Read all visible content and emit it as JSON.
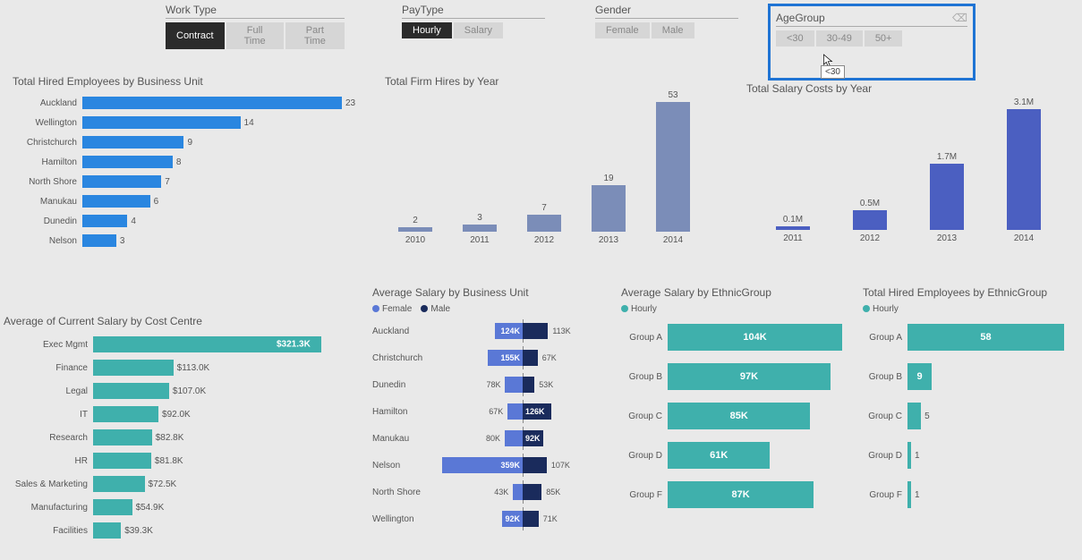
{
  "slicers": {
    "workType": {
      "title": "Work Type",
      "options": [
        "Contract",
        "Full Time",
        "Part Time"
      ],
      "active": 0
    },
    "payType": {
      "title": "PayType",
      "options": [
        "Hourly",
        "Salary"
      ],
      "active": 0
    },
    "gender": {
      "title": "Gender",
      "options": [
        "Female",
        "Male"
      ],
      "active": -1
    },
    "ageGroup": {
      "title": "AgeGroup",
      "options": [
        "<30",
        "30-49",
        "50+"
      ],
      "active": -1,
      "tooltip": "<30"
    }
  },
  "charts": {
    "hiredByBU": {
      "title": "Total Hired Employees by Business Unit",
      "rows": [
        {
          "label": "Auckland",
          "value": 23
        },
        {
          "label": "Wellington",
          "value": 14
        },
        {
          "label": "Christchurch",
          "value": 9
        },
        {
          "label": "Hamilton",
          "value": 8
        },
        {
          "label": "North Shore",
          "value": 7
        },
        {
          "label": "Manukau",
          "value": 6
        },
        {
          "label": "Dunedin",
          "value": 4
        },
        {
          "label": "Nelson",
          "value": 3
        }
      ]
    },
    "salaryByCC": {
      "title": "Average of Current Salary by Cost Centre",
      "rows": [
        {
          "label": "Exec Mgmt",
          "value_label": "$321.3K",
          "value": 321.3
        },
        {
          "label": "Finance",
          "value_label": "$113.0K",
          "value": 113.0
        },
        {
          "label": "Legal",
          "value_label": "$107.0K",
          "value": 107.0
        },
        {
          "label": "IT",
          "value_label": "$92.0K",
          "value": 92.0
        },
        {
          "label": "Research",
          "value_label": "$82.8K",
          "value": 82.8
        },
        {
          "label": "HR",
          "value_label": "$81.8K",
          "value": 81.8
        },
        {
          "label": "Sales & Marketing",
          "value_label": "$72.5K",
          "value": 72.5
        },
        {
          "label": "Manufacturing",
          "value_label": "$54.9K",
          "value": 54.9
        },
        {
          "label": "Facilities",
          "value_label": "$39.3K",
          "value": 39.3
        }
      ]
    },
    "hiresByYear": {
      "title": "Total Firm Hires by Year",
      "cols": [
        {
          "label": "2010",
          "value": 2
        },
        {
          "label": "2011",
          "value": 3
        },
        {
          "label": "2012",
          "value": 7
        },
        {
          "label": "2013",
          "value": 19
        },
        {
          "label": "2014",
          "value": 53
        }
      ]
    },
    "salaryCostsByYear": {
      "title": "Total Salary Costs by Year",
      "cols": [
        {
          "label": "2011",
          "value_label": "0.1M",
          "value": 0.1
        },
        {
          "label": "2012",
          "value_label": "0.5M",
          "value": 0.5
        },
        {
          "label": "2013",
          "value_label": "1.7M",
          "value": 1.7
        },
        {
          "label": "2014",
          "value_label": "3.1M",
          "value": 3.1
        }
      ]
    },
    "salaryByBU": {
      "title": "Average Salary by Business Unit",
      "legend": {
        "female": "Female",
        "male": "Male"
      },
      "rows": [
        {
          "label": "Auckland",
          "female": 124,
          "female_label": "124K",
          "male": 113,
          "male_label": "113K",
          "f_in": true,
          "m_in": false
        },
        {
          "label": "Christchurch",
          "female": 155,
          "female_label": "155K",
          "male": 67,
          "male_label": "67K",
          "f_in": true,
          "m_in": false
        },
        {
          "label": "Dunedin",
          "female": 78,
          "female_label": "78K",
          "male": 53,
          "male_label": "53K",
          "f_in": false,
          "m_in": false
        },
        {
          "label": "Hamilton",
          "female": 67,
          "female_label": "67K",
          "male": 126,
          "male_label": "126K",
          "f_in": false,
          "m_in": true
        },
        {
          "label": "Manukau",
          "female": 80,
          "female_label": "80K",
          "male": 92,
          "male_label": "92K",
          "f_in": false,
          "m_in": true
        },
        {
          "label": "Nelson",
          "female": 359,
          "female_label": "359K",
          "male": 107,
          "male_label": "107K",
          "f_in": true,
          "m_in": false
        },
        {
          "label": "North Shore",
          "female": 43,
          "female_label": "43K",
          "male": 85,
          "male_label": "85K",
          "f_in": false,
          "m_in": false
        },
        {
          "label": "Wellington",
          "female": 92,
          "female_label": "92K",
          "male": 71,
          "male_label": "71K",
          "f_in": true,
          "m_in": false
        }
      ]
    },
    "salaryByEthnic": {
      "title": "Average Salary by EthnicGroup",
      "legend": "Hourly",
      "rows": [
        {
          "label": "Group A",
          "value": 104,
          "value_label": "104K"
        },
        {
          "label": "Group B",
          "value": 97,
          "value_label": "97K"
        },
        {
          "label": "Group C",
          "value": 85,
          "value_label": "85K"
        },
        {
          "label": "Group D",
          "value": 61,
          "value_label": "61K"
        },
        {
          "label": "Group F",
          "value": 87,
          "value_label": "87K"
        }
      ]
    },
    "hiredByEthnic": {
      "title": "Total Hired Employees by EthnicGroup",
      "legend": "Hourly",
      "rows": [
        {
          "label": "Group A",
          "value": 58
        },
        {
          "label": "Group B",
          "value": 9
        },
        {
          "label": "Group C",
          "value": 5
        },
        {
          "label": "Group D",
          "value": 1
        },
        {
          "label": "Group F",
          "value": 1
        }
      ]
    }
  },
  "chart_data": [
    {
      "type": "bar",
      "title": "Total Hired Employees by Business Unit",
      "categories": [
        "Auckland",
        "Wellington",
        "Christchurch",
        "Hamilton",
        "North Shore",
        "Manukau",
        "Dunedin",
        "Nelson"
      ],
      "values": [
        23,
        14,
        9,
        8,
        7,
        6,
        4,
        3
      ]
    },
    {
      "type": "bar",
      "title": "Average of Current Salary by Cost Centre",
      "categories": [
        "Exec Mgmt",
        "Finance",
        "Legal",
        "IT",
        "Research",
        "HR",
        "Sales & Marketing",
        "Manufacturing",
        "Facilities"
      ],
      "values": [
        321.3,
        113.0,
        107.0,
        92.0,
        82.8,
        81.8,
        72.5,
        54.9,
        39.3
      ],
      "ylabel": "$K"
    },
    {
      "type": "bar",
      "title": "Total Firm Hires by Year",
      "categories": [
        "2010",
        "2011",
        "2012",
        "2013",
        "2014"
      ],
      "values": [
        2,
        3,
        7,
        19,
        53
      ]
    },
    {
      "type": "bar",
      "title": "Total Salary Costs by Year",
      "categories": [
        "2011",
        "2012",
        "2013",
        "2014"
      ],
      "values": [
        0.1,
        0.5,
        1.7,
        3.1
      ],
      "ylabel": "M"
    },
    {
      "type": "bar",
      "title": "Average Salary by Business Unit",
      "categories": [
        "Auckland",
        "Christchurch",
        "Dunedin",
        "Hamilton",
        "Manukau",
        "Nelson",
        "North Shore",
        "Wellington"
      ],
      "series": [
        {
          "name": "Female",
          "values": [
            124,
            155,
            78,
            67,
            80,
            359,
            43,
            92
          ]
        },
        {
          "name": "Male",
          "values": [
            113,
            67,
            53,
            126,
            92,
            107,
            85,
            71
          ]
        }
      ],
      "ylabel": "K"
    },
    {
      "type": "bar",
      "title": "Average Salary by EthnicGroup",
      "categories": [
        "Group A",
        "Group B",
        "Group C",
        "Group D",
        "Group F"
      ],
      "values": [
        104,
        97,
        85,
        61,
        87
      ],
      "ylabel": "K",
      "series_name": "Hourly"
    },
    {
      "type": "bar",
      "title": "Total Hired Employees by EthnicGroup",
      "categories": [
        "Group A",
        "Group B",
        "Group C",
        "Group D",
        "Group F"
      ],
      "values": [
        58,
        9,
        5,
        1,
        1
      ],
      "series_name": "Hourly"
    }
  ]
}
